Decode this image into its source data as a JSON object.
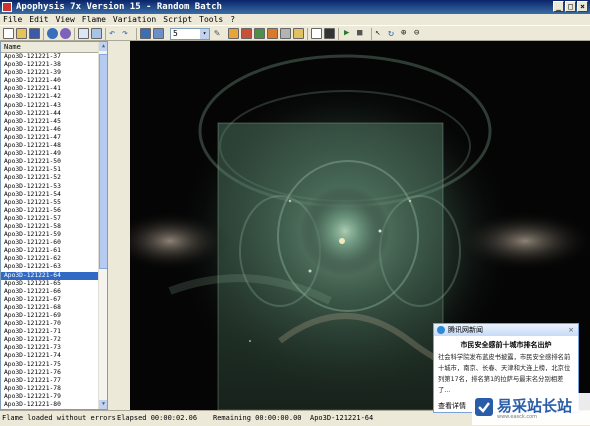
{
  "window": {
    "title": "Apophysis 7x Version 15 - Random Batch",
    "minimize": "_",
    "maximize": "□",
    "close": "×"
  },
  "menu": [
    "File",
    "Edit",
    "View",
    "Flame",
    "Variation",
    "Script",
    "Tools",
    "?"
  ],
  "toolbar": {
    "combo_value": "5",
    "combo_arrow": "▾"
  },
  "list": {
    "header": "Name",
    "items": [
      "Apo3D-121221-37",
      "Apo3D-121221-38",
      "Apo3D-121221-39",
      "Apo3D-121221-40",
      "Apo3D-121221-41",
      "Apo3D-121221-42",
      "Apo3D-121221-43",
      "Apo3D-121221-44",
      "Apo3D-121221-45",
      "Apo3D-121221-46",
      "Apo3D-121221-47",
      "Apo3D-121221-48",
      "Apo3D-121221-49",
      "Apo3D-121221-50",
      "Apo3D-121221-51",
      "Apo3D-121221-52",
      "Apo3D-121221-53",
      "Apo3D-121221-54",
      "Apo3D-121221-55",
      "Apo3D-121221-56",
      "Apo3D-121221-57",
      "Apo3D-121221-58",
      "Apo3D-121221-59",
      "Apo3D-121221-60",
      "Apo3D-121221-61",
      "Apo3D-121221-62",
      "Apo3D-121221-63",
      "Apo3D-121221-64",
      "Apo3D-121221-65",
      "Apo3D-121221-66",
      "Apo3D-121221-67",
      "Apo3D-121221-68",
      "Apo3D-121221-69",
      "Apo3D-121221-70",
      "Apo3D-121221-71",
      "Apo3D-121221-72",
      "Apo3D-121221-73",
      "Apo3D-121221-74",
      "Apo3D-121221-75",
      "Apo3D-121221-76",
      "Apo3D-121221-77",
      "Apo3D-121221-78",
      "Apo3D-121221-79",
      "Apo3D-121221-80",
      "Apo3D-121221-81"
    ],
    "selected": "Apo3D-121221-64"
  },
  "status": {
    "message": "Flame loaded without errors",
    "elapsed": "Elapsed 00:00:02.06",
    "remaining": "Remaining 00:00:00.00",
    "current": "Apo3D-121221-64"
  },
  "popup": {
    "header": "腾讯网新闻",
    "close": "×",
    "title": "市民安全感前十城市排名出炉",
    "body": "社会科学院发布蓝皮书披露，市民安全感排名前十城市，南京、长春、天津和大连上榜，北京位列第17名，排名第1的拉萨与最末名分别相差了...",
    "view": "查看详情"
  },
  "watermark": {
    "text": "易采站长站",
    "sub": "www.easck.com"
  },
  "colors": {
    "title_bar": "#0a246a",
    "selection": "#316ac5",
    "preview_bg": "#050505",
    "flame": "#9fc7a8"
  }
}
